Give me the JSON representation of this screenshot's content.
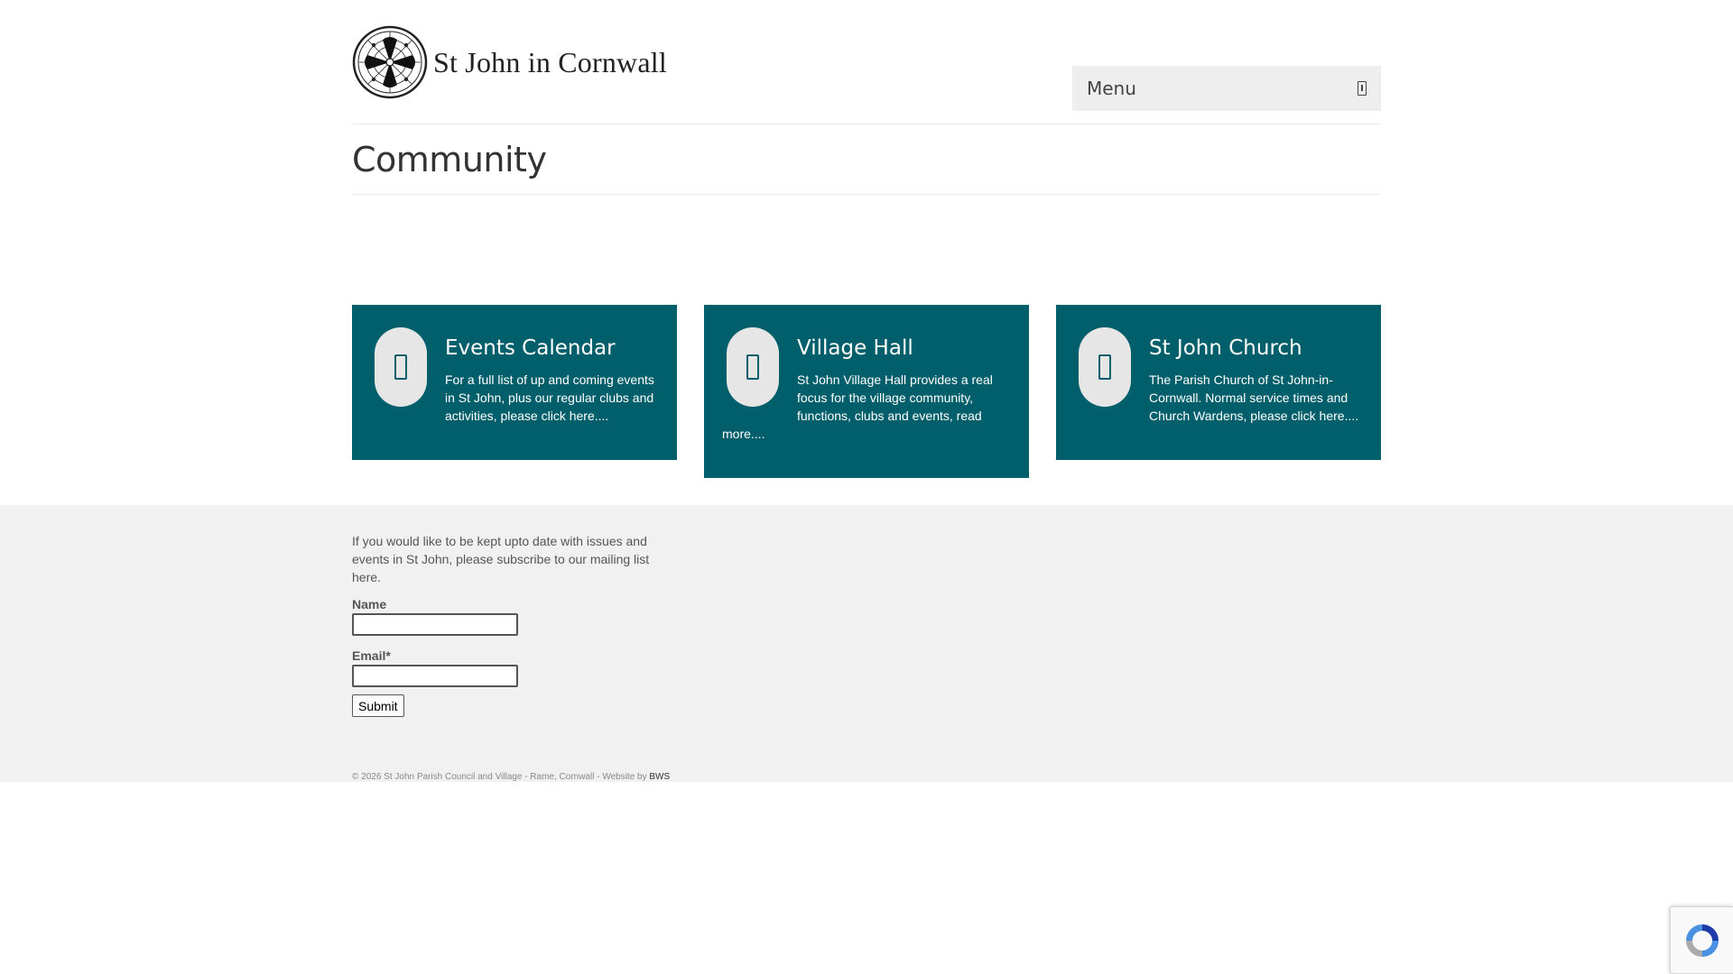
{
  "site": {
    "logo_text": "St John in Cornwall",
    "menu_label": "Menu"
  },
  "page": {
    "title": "Community"
  },
  "cards": [
    {
      "title": "Events Calendar",
      "text": "For a full list of up and coming events in St John, plus our regular clubs and activities, please click here...."
    },
    {
      "title": "Village Hall",
      "text": "St John Village Hall provides a real focus for the village community, functions, clubs and events, read more...."
    },
    {
      "title": "St John Church",
      "text": "The Parish Church of St John-in-Cornwall. Normal service times and Church Wardens, please click here...."
    }
  ],
  "subscribe": {
    "intro": "If you would like to be kept upto date with issues and events in St John, please subscribe to our mailing list here.",
    "name_label": "Name",
    "name_value": "",
    "email_label": "Email*",
    "email_value": "",
    "submit_label": "Submit"
  },
  "footer": {
    "copyright": "© 2026 St John Parish Council and Village - Rame, Cornwall - Website by ",
    "credit_link": "BWS"
  },
  "icons": {
    "logo": "parish-emblem-icon",
    "menu": "menu-toggle-icon",
    "card": "document-icon",
    "recaptcha": "recaptcha-icon"
  },
  "colors": {
    "card_background": "#005f6b",
    "footer_background": "#f1f1f1",
    "menu_background": "#eeeeee"
  }
}
